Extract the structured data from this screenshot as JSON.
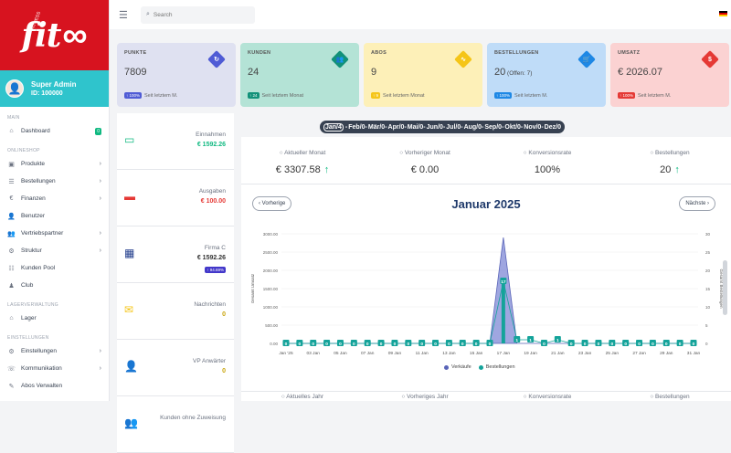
{
  "brand": {
    "logo_text": "fit",
    "logo_symbol": "∞",
    "logo_tiny": "FITNESS"
  },
  "user": {
    "name": "Super Admin",
    "id": "ID: 100000",
    "avatar_emoji": "👤"
  },
  "sidebar": {
    "section_main": "MAIN",
    "section_shop": "ONLINESHOP",
    "section_lager": "LAGERVERWALTUNG",
    "section_settings": "EINSTELLUNGEN",
    "dashboard": {
      "label": "Dashboard",
      "badge": "0"
    },
    "items_shop": [
      {
        "label": "Produkte",
        "icon": "box-icon"
      },
      {
        "label": "Bestellungen",
        "icon": "list-icon"
      },
      {
        "label": "Finanzen",
        "icon": "finance-icon"
      },
      {
        "label": "Benutzer",
        "icon": "user-icon"
      },
      {
        "label": "Vertriebspartner",
        "icon": "partner-icon"
      },
      {
        "label": "Struktur",
        "icon": "structure-icon"
      },
      {
        "label": "Kunden Pool",
        "icon": "pool-icon"
      },
      {
        "label": "Club",
        "icon": "club-icon"
      }
    ],
    "lager": {
      "label": "Lager"
    },
    "items_settings": [
      {
        "label": "Einstellungen"
      },
      {
        "label": "Kommunikation"
      },
      {
        "label": "Abos Verwalten"
      }
    ]
  },
  "topbar": {
    "search_placeholder": "Search"
  },
  "cards": [
    {
      "title": "PUNKTE",
      "value": "7809",
      "sub": "",
      "pill": "↑ 100%",
      "foot": "Seit letztem M.",
      "bg": "#dfe1f1",
      "accent": "#4f5bd5",
      "pill_color": "#4f5bd5",
      "icon": "rotate-icon",
      "glyph": "↻"
    },
    {
      "title": "KUNDEN",
      "value": "24",
      "sub": "",
      "pill": "↑ 24",
      "foot": "Seit letztem Monat",
      "bg": "#b4e3d6",
      "accent": "#119179",
      "pill_color": "#119179",
      "icon": "users-icon",
      "glyph": "👥"
    },
    {
      "title": "ABOS",
      "value": "9",
      "sub": "",
      "pill": "↑ 9",
      "foot": "Seit letztem Monat",
      "bg": "#fdf0b8",
      "accent": "#f5c518",
      "pill_color": "#f5c518",
      "icon": "pulse-icon",
      "glyph": "∿"
    },
    {
      "title": "BESTELLUNGEN",
      "value": "20",
      "sub": " (Offen: 7)",
      "pill": "↑ 100%",
      "foot": "Seit letztem M.",
      "bg": "#bfdcf8",
      "accent": "#1e88e5",
      "pill_color": "#1e88e5",
      "icon": "basket-icon",
      "glyph": "🛒"
    },
    {
      "title": "UMSATZ",
      "value": "€ 2026.07",
      "sub": "",
      "pill": "↑ 100%",
      "foot": "Seit letztem M.",
      "bg": "#fbd2d2",
      "accent": "#e53935",
      "pill_color": "#e53935",
      "icon": "money-icon",
      "glyph": "$"
    }
  ],
  "months": [
    "Jan/4",
    "Feb/0",
    "Mär/0",
    "Apr/0",
    "Mai/0",
    "Jun/0",
    "Jul/0",
    "Aug/0",
    "Sep/0",
    "Okt/0",
    "Nov/0",
    "Dez/0"
  ],
  "left_stats": [
    {
      "label": "Einnahmen",
      "value": "€ 1592.26",
      "value_color": "#10b981",
      "icon": "wallet-icon",
      "glyph": "▭",
      "icon_color": "#10b981",
      "badge": ""
    },
    {
      "label": "Ausgaben",
      "value": "€ 100.00",
      "value_color": "#e53935",
      "icon": "card-icon",
      "glyph": "▬",
      "icon_color": "#e53935",
      "badge": ""
    },
    {
      "label": "Firma C",
      "value": "€ 1592.26",
      "value_color": "#333",
      "icon": "building-icon",
      "glyph": "▦",
      "icon_color": "#1e3a8a",
      "badge": "↑ 94.69%"
    },
    {
      "label": "Nachrichten",
      "value": "0",
      "value_color": "#c9a40a",
      "icon": "mail-icon",
      "glyph": "✉",
      "icon_color": "#f5c518",
      "badge": ""
    },
    {
      "label": "VP Anwärter",
      "value": "0",
      "value_color": "#c9a40a",
      "icon": "user-plus-icon",
      "glyph": "👤",
      "icon_color": "#6d28d9",
      "badge": ""
    },
    {
      "label": "Kunden ohne Zuweisung",
      "value": "",
      "value_color": "#333",
      "icon": "users-group-icon",
      "glyph": "👥",
      "icon_color": "#1e88e5",
      "badge": ""
    }
  ],
  "kpis": [
    {
      "label": "○ Aktueller Monat",
      "value": "€ 3307.58",
      "up": "↑"
    },
    {
      "label": "○ Vorheriger Monat",
      "value": "€ 0.00",
      "up": ""
    },
    {
      "label": "○ Konversionsrate",
      "value": "100%",
      "up": ""
    },
    {
      "label": "○ Bestellungen",
      "value": "20",
      "up": "↑"
    }
  ],
  "chart_nav": {
    "prev": "‹ Vorherige",
    "next": "Nächste ›",
    "title": "Januar 2025"
  },
  "bottom_labels": [
    "○ Aktuelles Jahr",
    "○ Vorheriges Jahr",
    "○ Konversionsrate",
    "○ Bestellungen"
  ],
  "chart_data": {
    "type": "area",
    "x": [
      "01 Jan",
      "02 Jan",
      "03 Jan",
      "04 Jan",
      "05 Jan",
      "06 Jan",
      "07 Jan",
      "08 Jan",
      "09 Jan",
      "10 Jan",
      "11 Jan",
      "12 Jan",
      "13 Jan",
      "14 Jan",
      "15 Jan",
      "16 Jan",
      "17 Jan",
      "18 Jan",
      "19 Jan",
      "20 Jan",
      "21 Jan",
      "22 Jan",
      "23 Jan",
      "24 Jan",
      "25 Jan",
      "26 Jan",
      "27 Jan",
      "28 Jan",
      "29 Jan",
      "30 Jan",
      "31 Jan"
    ],
    "xticks": [
      "Jan '25",
      "03 Jan",
      "05 Jan",
      "07 Jan",
      "09 Jan",
      "11 Jan",
      "13 Jan",
      "15 Jan",
      "17 Jan",
      "19 Jan",
      "21 Jan",
      "23 Jan",
      "25 Jan",
      "27 Jan",
      "29 Jan",
      "31 Jan"
    ],
    "xtick_index": [
      0,
      2,
      4,
      6,
      8,
      10,
      12,
      14,
      16,
      18,
      20,
      22,
      24,
      26,
      28,
      30
    ],
    "series": [
      {
        "name": "Verkäufe",
        "color": "#5964b8",
        "values": [
          0,
          0,
          0,
          0,
          0,
          0,
          0,
          0,
          0,
          0,
          0,
          0,
          0,
          0,
          0,
          0,
          2900,
          0,
          0,
          0,
          0,
          0,
          0,
          0,
          0,
          0,
          0,
          0,
          0,
          0,
          0
        ]
      },
      {
        "name": "Bestellungen",
        "color": "#14a39a",
        "values": [
          0,
          0,
          0,
          0,
          0,
          0,
          0,
          0,
          0,
          0,
          0,
          0,
          0,
          0,
          0,
          0,
          17,
          1,
          1,
          0,
          1,
          0,
          0,
          0,
          0,
          0,
          0,
          0,
          0,
          0,
          0
        ]
      }
    ],
    "ylabel_left": "Gesamt Umsatz",
    "ylabel_right": "Gesamt Bestellungen",
    "yticks_left": [
      "0.00",
      "500.00",
      "1000.00",
      "1500.00",
      "2000.00",
      "2500.00",
      "3000.00"
    ],
    "ylim_left": [
      0,
      3000
    ],
    "yticks_right": [
      "0",
      "5",
      "10",
      "15",
      "20",
      "25",
      "30"
    ],
    "ylim_right": [
      0,
      30
    ]
  }
}
